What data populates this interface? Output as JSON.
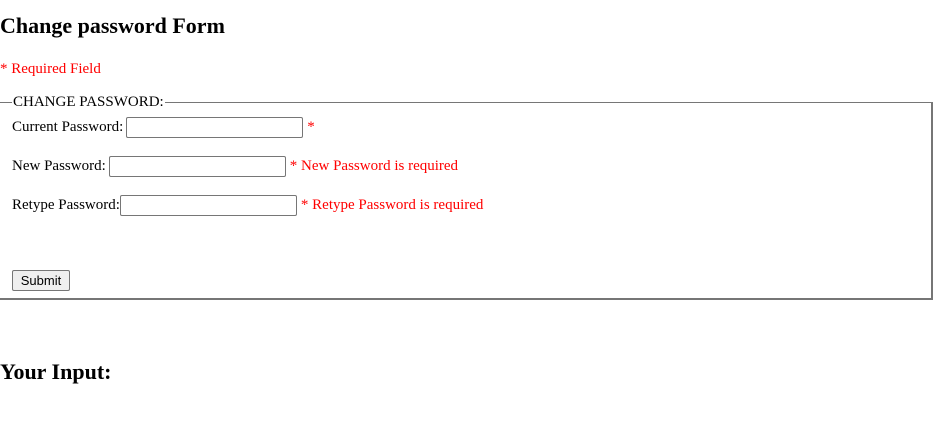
{
  "page": {
    "title": "Change password Form",
    "required_note": "* Required Field"
  },
  "form": {
    "legend": "CHANGE PASSWORD:",
    "fields": [
      {
        "label": "Current Password:",
        "value": "",
        "error": "*"
      },
      {
        "label": "New Password:",
        "value": "",
        "error": "* New Password is required"
      },
      {
        "label": "Retype Password:",
        "value": "",
        "error": "* Retype Password is required"
      }
    ],
    "submit_label": "Submit"
  },
  "output": {
    "heading": "Your Input:"
  },
  "colors": {
    "error": "#ff0000",
    "border": "#767676",
    "button_bg": "#efefef"
  }
}
